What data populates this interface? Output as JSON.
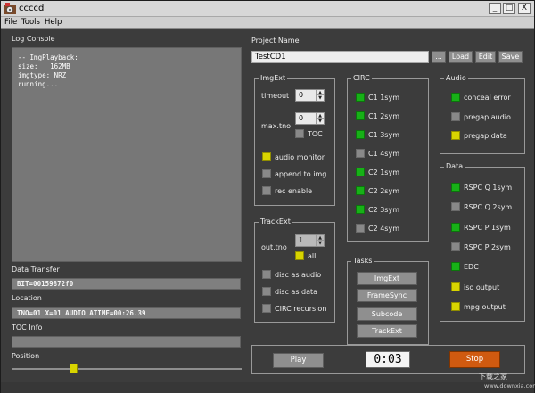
{
  "window": {
    "title": "ccccd",
    "min_label": "_",
    "max_label": "□",
    "close_label": "X"
  },
  "menu": {
    "items": [
      "File",
      "Tools",
      "Help"
    ]
  },
  "log": {
    "label": "Log Console",
    "text": "-- ImgPlayback:\nsize:   162MB\nimgtype: NRZ\nrunning..."
  },
  "data_transfer": {
    "label": "Data Transfer",
    "value": "BIT=00159872f0"
  },
  "location": {
    "label": "Location",
    "value": "TNO=01 X=01 AUDIO ATIME=00:26.39"
  },
  "toc_info": {
    "label": "TOC Info",
    "value": ""
  },
  "position": {
    "label": "Position",
    "value": 0.27
  },
  "project": {
    "label": "Project Name",
    "value": "TestCD1",
    "browse_label": "...",
    "load_label": "Load",
    "edit_label": "Edit",
    "save_label": "Save"
  },
  "imgext": {
    "title": "ImgExt",
    "timeout_label": "timeout",
    "timeout_value": "0",
    "maxtno_label": "max.tno",
    "maxtno_value": "0",
    "toc_label": "TOC",
    "audio_monitor_label": "audio monitor",
    "append_label": "append to img",
    "rec_enable_label": "rec enable"
  },
  "trackext": {
    "title": "TrackExt",
    "outtno_label": "out.tno",
    "outtno_value": "1",
    "all_label": "all",
    "disc_audio_label": "disc as audio",
    "disc_data_label": "disc as data",
    "circ_recursion_label": "CIRC recursion"
  },
  "circ": {
    "title": "CIRC",
    "items": [
      {
        "label": "C1 1sym",
        "status": "green"
      },
      {
        "label": "C1 2sym",
        "status": "green"
      },
      {
        "label": "C1 3sym",
        "status": "green"
      },
      {
        "label": "C1 4sym",
        "status": "gray"
      },
      {
        "label": "C2 1sym",
        "status": "green"
      },
      {
        "label": "C2 2sym",
        "status": "green"
      },
      {
        "label": "C2 3sym",
        "status": "green"
      },
      {
        "label": "C2 4sym",
        "status": "gray"
      }
    ]
  },
  "audio": {
    "title": "Audio",
    "items": [
      {
        "label": "conceal error",
        "status": "green"
      },
      {
        "label": "pregap audio",
        "status": "gray"
      },
      {
        "label": "pregap data",
        "status": "yellow"
      }
    ]
  },
  "data": {
    "title": "Data",
    "items": [
      {
        "label": "RSPC Q 1sym",
        "status": "green"
      },
      {
        "label": "RSPC Q 2sym",
        "status": "gray"
      },
      {
        "label": "RSPC P 1sym",
        "status": "green"
      },
      {
        "label": "RSPC P 2sym",
        "status": "gray"
      },
      {
        "label": "EDC",
        "status": "green"
      },
      {
        "label": "iso output",
        "status": "yellow"
      },
      {
        "label": "mpg output",
        "status": "yellow"
      }
    ]
  },
  "tasks": {
    "title": "Tasks",
    "buttons": [
      "ImgExt",
      "FrameSync",
      "Subcode",
      "TrackExt"
    ]
  },
  "controls": {
    "play_label": "Play",
    "timer": "0:03",
    "stop_label": "Stop"
  },
  "watermark": {
    "text": "下载之家",
    "url": "www.downxia.com"
  },
  "colors": {
    "green": "#17b117",
    "yellow": "#d8d400",
    "gray": "#898989",
    "stop": "#d05a10"
  }
}
